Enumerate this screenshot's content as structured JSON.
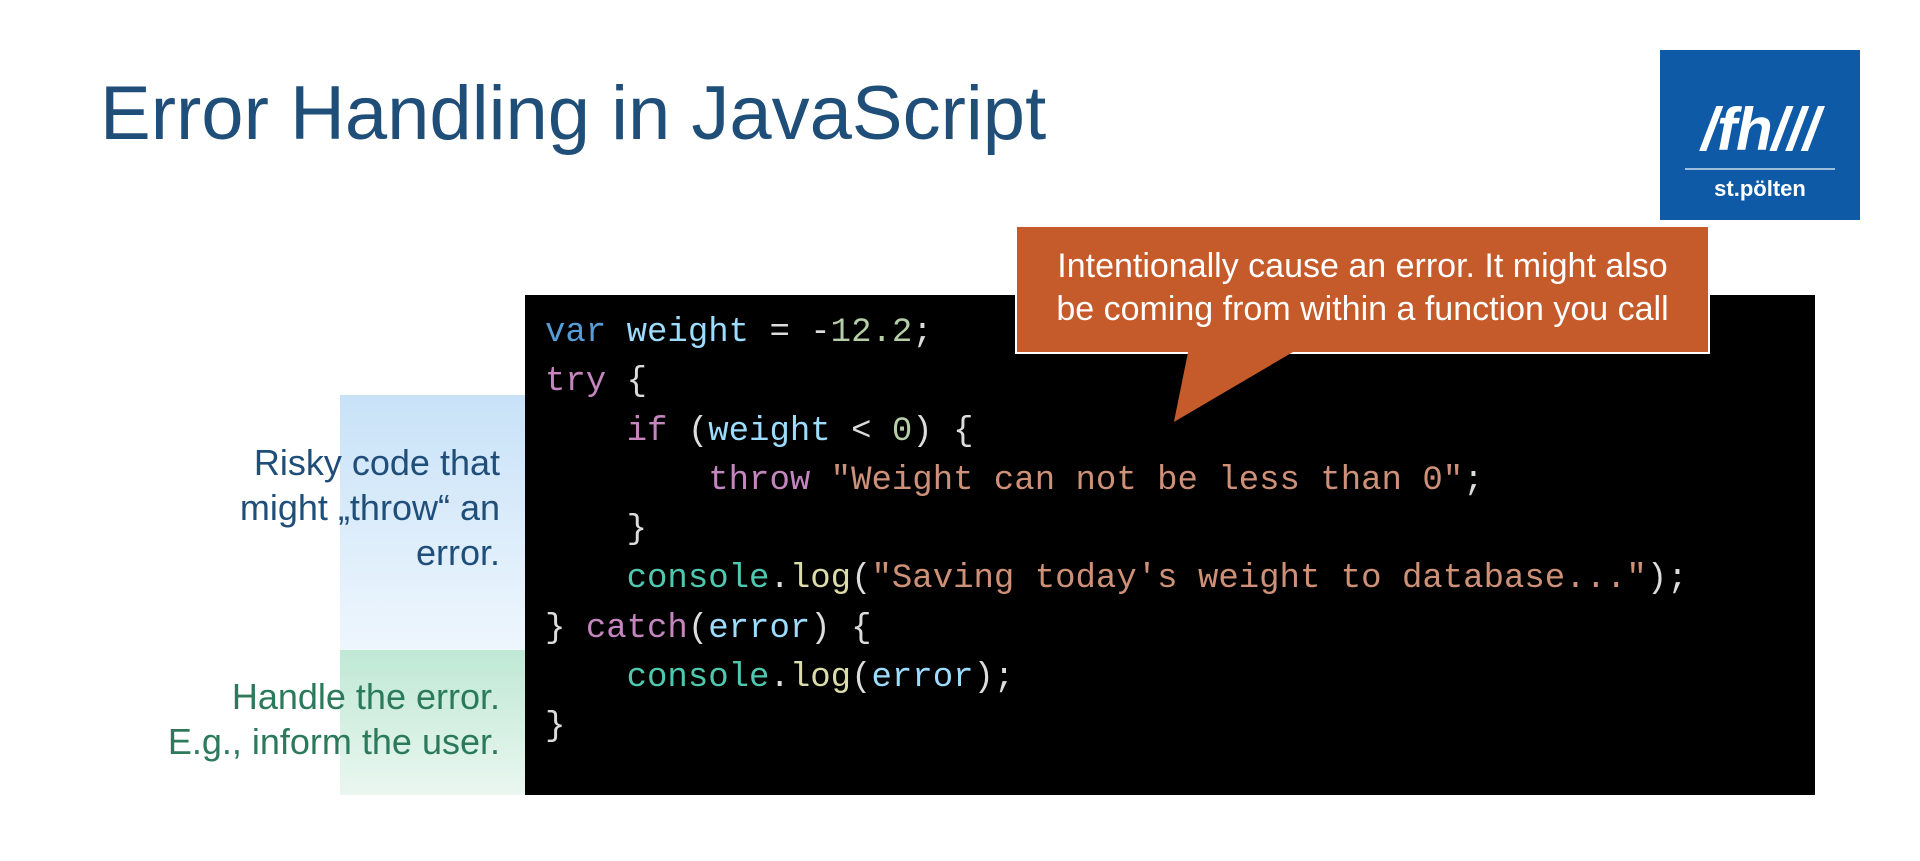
{
  "title": "Error Handling in JavaScript",
  "logo": {
    "main": "/fh///",
    "sub": "st.pölten"
  },
  "annotations": {
    "risky": "Risky code that\nmight „throw“ an\nerror.",
    "handle": "Handle the error.\nE.g., inform the user."
  },
  "callout": "Intentionally cause an error. It might also be coming from within a function you call",
  "code": {
    "var": "var",
    "weight1": "weight",
    "assign": " = ",
    "numNeg": "-",
    "numVal": "12.2",
    "semi": ";",
    "try": "try",
    "brace_open": " {",
    "if": "if",
    "paren_open": " (",
    "weight2": "weight",
    "lt": " < ",
    "zero": "0",
    "paren_close": ") {",
    "throw": "throw",
    "str_throw": "\"Weight can not be less than 0\"",
    "brace_close1": "    }",
    "console1": "console",
    "dot": ".",
    "log1": "log",
    "str_log1": "\"Saving today's weight to database...\"",
    "end_try": "} ",
    "catch": "catch",
    "error_p_open": "(",
    "error_id": "error",
    "error_p_close": ") {",
    "console2": "console",
    "log2": "log",
    "error_arg": "error",
    "brace_close2": "}"
  }
}
